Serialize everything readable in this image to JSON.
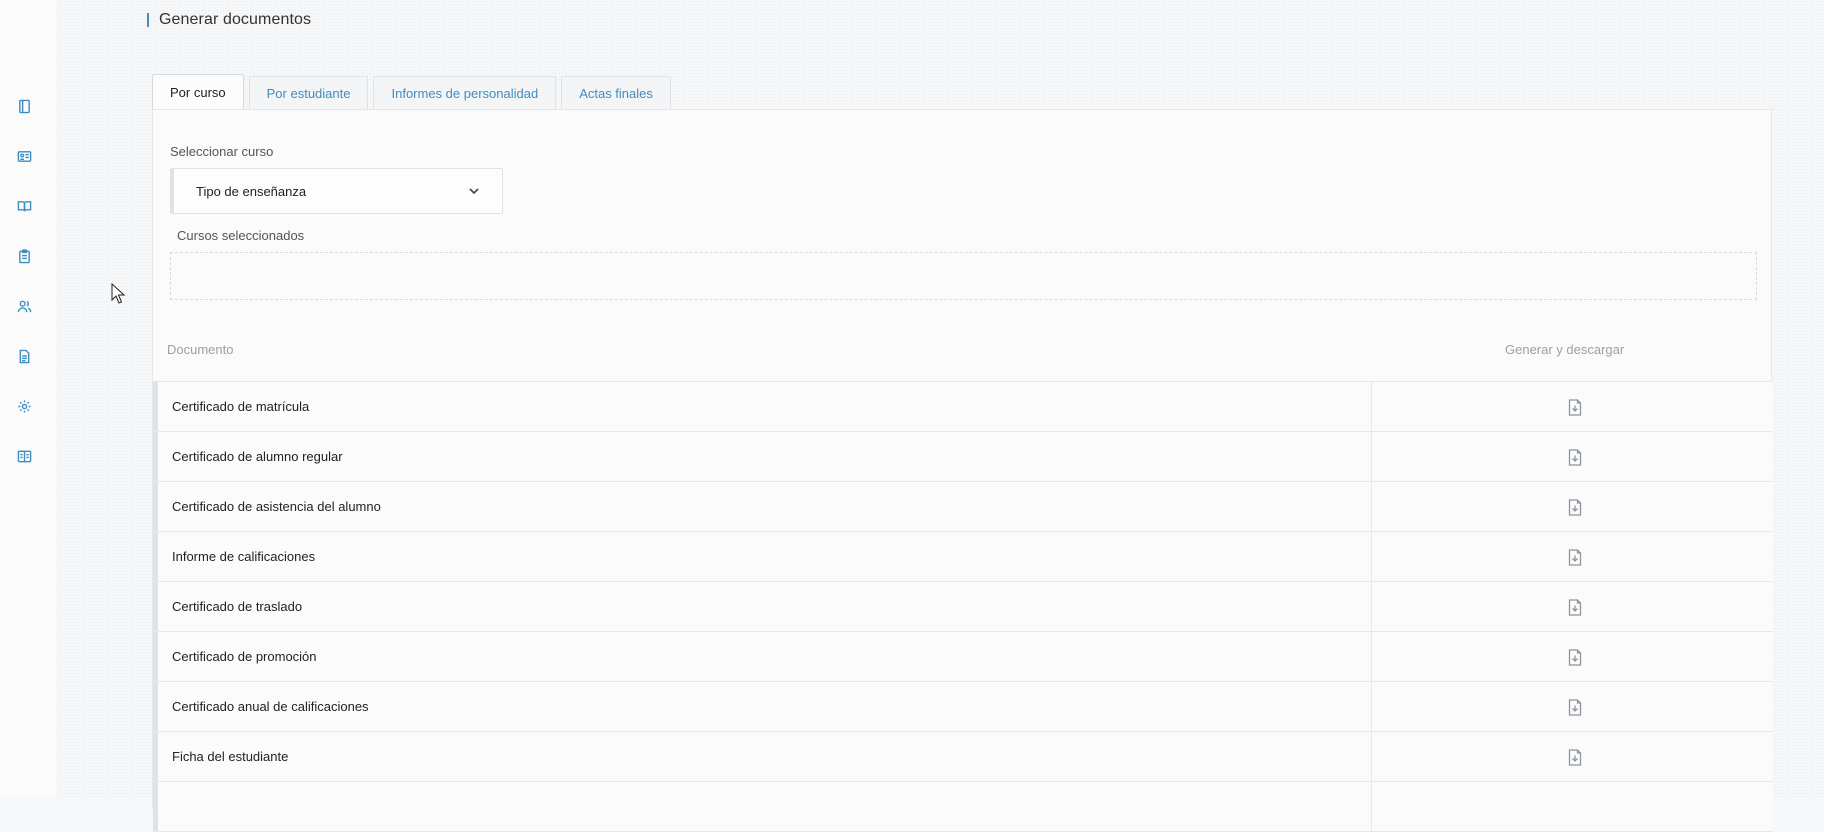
{
  "header": {
    "title": "Generar documentos"
  },
  "sidebar": {
    "items": [
      {
        "icon": "notebook-icon"
      },
      {
        "icon": "id-card-icon"
      },
      {
        "icon": "open-book-icon"
      },
      {
        "icon": "clipboard-icon"
      },
      {
        "icon": "users-icon"
      },
      {
        "icon": "document-icon"
      },
      {
        "icon": "gear-icon"
      },
      {
        "icon": "reading-book-icon"
      }
    ],
    "accent_color": "#3f8dbf"
  },
  "tabs": [
    {
      "label": "Por curso",
      "active": true
    },
    {
      "label": "Por estudiante",
      "active": false
    },
    {
      "label": "Informes de personalidad",
      "active": false
    },
    {
      "label": "Actas finales",
      "active": false
    }
  ],
  "form": {
    "select_label": "Seleccionar curso",
    "select_value": "Tipo de enseñanza",
    "selected_label": "Cursos seleccionados"
  },
  "table": {
    "headers": {
      "document": "Documento",
      "action": "Generar y descargar"
    },
    "rows": [
      {
        "label": "Certificado de matrícula",
        "action_icon": "download-file-icon"
      },
      {
        "label": "Certificado de alumno regular",
        "action_icon": "download-file-icon"
      },
      {
        "label": "Certificado de asistencia del alumno",
        "action_icon": "download-file-icon"
      },
      {
        "label": "Informe de calificaciones",
        "action_icon": "download-file-icon"
      },
      {
        "label": "Certificado de traslado",
        "action_icon": "download-file-icon"
      },
      {
        "label": "Certificado de promoción",
        "action_icon": "download-file-icon"
      },
      {
        "label": "Certificado anual de calificaciones",
        "action_icon": "download-file-icon"
      },
      {
        "label": "Ficha del estudiante",
        "action_icon": "download-file-icon"
      },
      {
        "label": "",
        "action_icon": ""
      }
    ]
  }
}
